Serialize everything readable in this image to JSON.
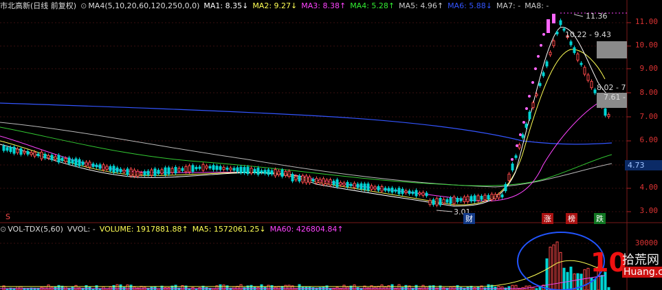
{
  "header": {
    "title": "市北高新(日线 前复权)",
    "indicator": "MA4(5,10,20,60,120,250,0,0)",
    "ma1": "MA1: 8.35↓",
    "ma2": "MA2: 9.27↓",
    "ma3": "MA3: 8.38↑",
    "ma4": "MA4: 5.28↑",
    "ma5": "MA5: 4.96↑",
    "ma6": "MA6: 5.88↓",
    "ma7": "MA7: -",
    "ma8": "MA8: -"
  },
  "price_axis": [
    "11.00",
    "10.00",
    "9.00",
    "8.00",
    "7.00",
    "6.00",
    "5.00",
    "4.00",
    "3.00"
  ],
  "current_price": "4.73",
  "annotations": {
    "high": "11.36",
    "low": "3.01",
    "mid_range": "10.22 - 9.43",
    "lower_range": "8.02 - 7",
    "lower_range2": "7.61 -"
  },
  "markers": {
    "cai": "财",
    "zhang": "涨",
    "bang": "榜",
    "die": "跌",
    "left_s": "S"
  },
  "volume_header": {
    "name": "VOL-TDX(5,60)",
    "vvol": "VVOL: -",
    "volume": "VOLUME: 1917881.88↑",
    "ma5": "MA5: 1572061.25↓",
    "ma60": "MA60: 426804.84↑"
  },
  "volume_axis": [
    "30000"
  ],
  "watermark": {
    "brand": "拾荒网",
    "site": "Huang.cn",
    "digits": "10"
  },
  "colors": {
    "up": "#ff4a4a",
    "down": "#00d4d4",
    "ma1": "#ffffff",
    "ma2": "#ffff55",
    "ma3": "#ff44ff",
    "ma4": "#33ee33",
    "ma5": "#cccccc",
    "ma6": "#3355ff",
    "limit_up": "#ff66ff",
    "ellipse": "#2255ff"
  }
}
